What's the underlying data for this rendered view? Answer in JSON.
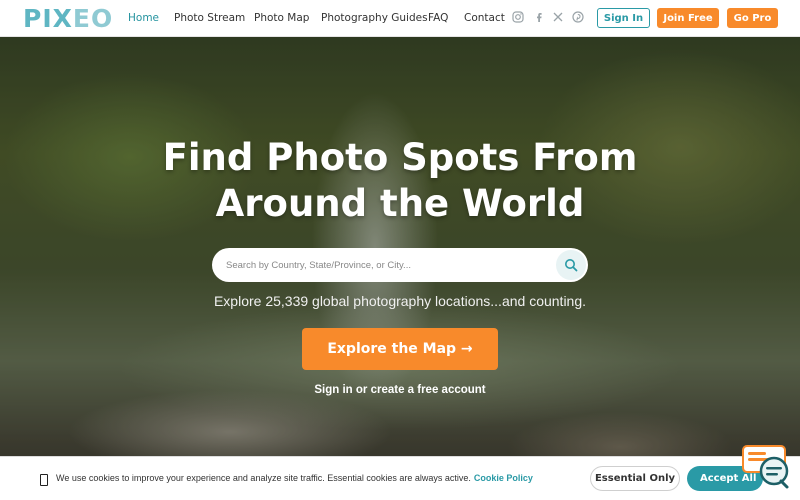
{
  "brand": {
    "logo_a": "PIX",
    "logo_b": "EO"
  },
  "nav": {
    "items": [
      {
        "label": "Home",
        "active": true
      },
      {
        "label": "Photo Stream"
      },
      {
        "label": "Photo Map"
      },
      {
        "label": "Photography Guides"
      },
      {
        "label": "FAQ"
      },
      {
        "label": "Contact"
      }
    ]
  },
  "social": [
    "instagram-icon",
    "facebook-icon",
    "x-icon",
    "pinterest-icon"
  ],
  "header_buttons": {
    "signin": "Sign In",
    "join": "Join Free",
    "pro": "Go Pro"
  },
  "hero": {
    "title_line1": "Find Photo Spots From",
    "title_line2": "Around the World",
    "search_placeholder": "Search by Country, State/Province, or City...",
    "subtitle": "Explore 25,339 global photography locations...and counting.",
    "cta": "Explore the Map →",
    "signin_text": "Sign in or create a free account"
  },
  "cookie": {
    "text": "We use cookies to improve your experience and analyze site traffic. Essential cookies are always active.",
    "policy_link": "Cookie Policy",
    "essential": "Essential Only",
    "accept": "Accept All"
  },
  "colors": {
    "accent": "#2a9aa6",
    "orange": "#f88a2b"
  }
}
